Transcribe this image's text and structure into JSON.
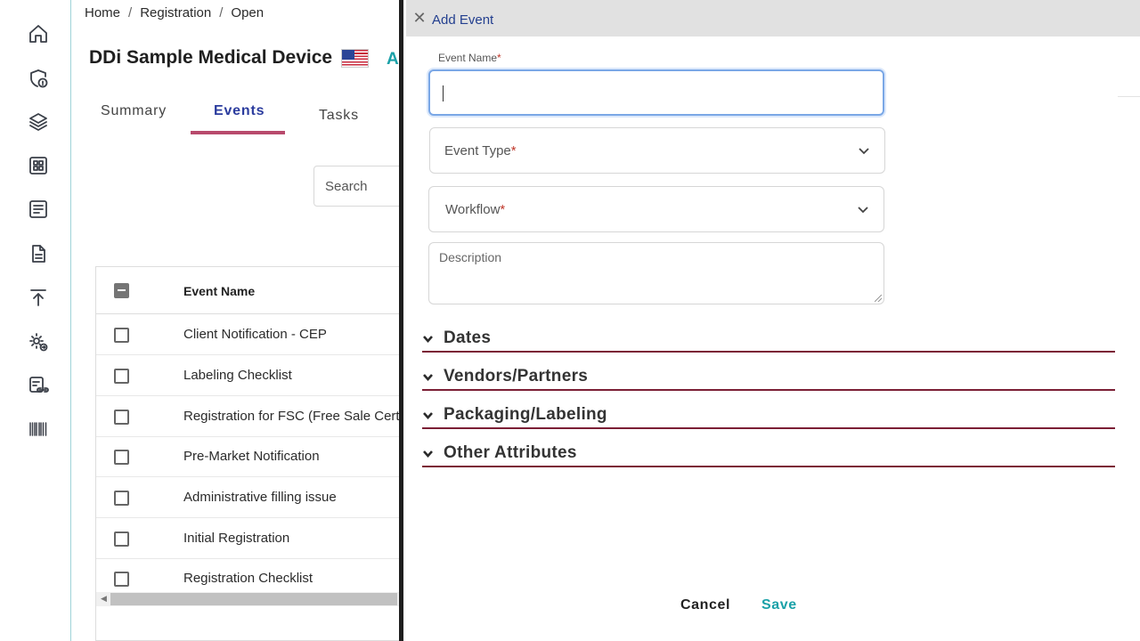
{
  "rail": {
    "icons": [
      "home-icon",
      "shield-info-icon",
      "layers-icon",
      "grid-icon",
      "list-document-icon",
      "file-icon",
      "upload-icon",
      "settings-gear-icon",
      "link-document-icon",
      "barcode-icon"
    ]
  },
  "breadcrumb": [
    "Home",
    "Registration",
    "Open"
  ],
  "page": {
    "title": "DDi Sample Medical Device",
    "action_letter": "A",
    "tabs": [
      "Summary",
      "Events",
      "Tasks"
    ],
    "active_tab": "Events",
    "search_placeholder": "Search"
  },
  "table": {
    "header": "Event Name",
    "rows": [
      "Client Notification - CEP",
      "Labeling Checklist",
      "Registration for FSC (Free Sale Cert",
      "Pre-Market Notification",
      "Administrative filling issue",
      "Initial Registration",
      "Registration Checklist"
    ]
  },
  "drawer": {
    "close_symbol": "✕",
    "title": "Add Event",
    "event_name_label": "Event Name",
    "event_name_value": "",
    "event_type_label": "Event Type",
    "workflow_label": "Workflow",
    "required_mark": "*",
    "description_placeholder": "Description",
    "sections": [
      "Dates",
      "Vendors/Partners",
      "Packaging/Labeling",
      "Other Attributes"
    ],
    "cancel_label": "Cancel",
    "save_label": "Save"
  },
  "colors": {
    "accent_teal": "#1aa1a8",
    "tab_active": "#2b3c9e",
    "tab_underline": "#b84a6c",
    "section_rule": "#7b1f35",
    "input_focus": "#7aa7e6"
  }
}
